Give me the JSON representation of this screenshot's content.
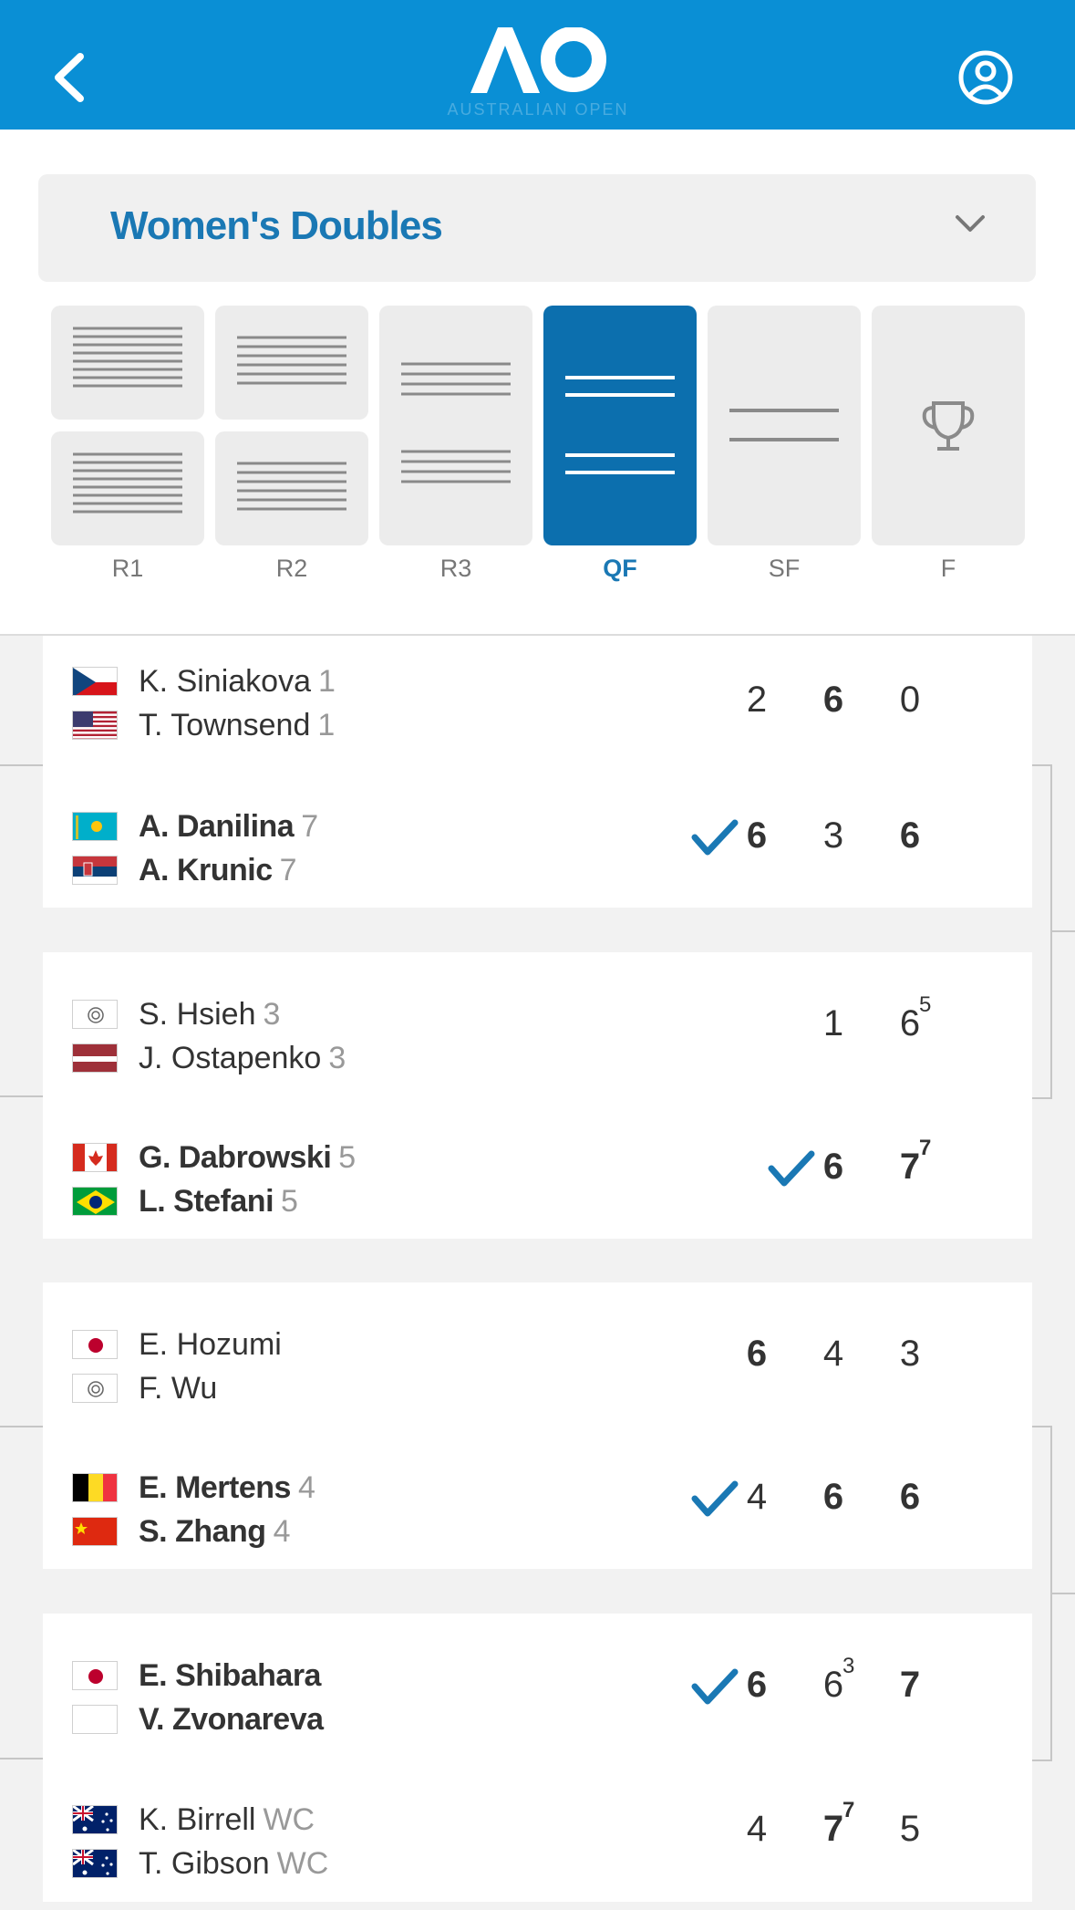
{
  "header": {
    "logo_text": "AO",
    "logo_subtext": "AUSTRALIAN OPEN",
    "brand_color": "#0a8fd5",
    "back_icon": "chevron-left-icon",
    "account_icon": "user-circle-icon"
  },
  "event_select": {
    "selected": "Women's Doubles",
    "icon": "chevron-down-icon"
  },
  "rounds": [
    {
      "label": "R1",
      "active": false
    },
    {
      "label": "R2",
      "active": false
    },
    {
      "label": "R3",
      "active": false
    },
    {
      "label": "QF",
      "active": true
    },
    {
      "label": "SF",
      "active": false
    },
    {
      "label": "F",
      "active": false,
      "icon": "trophy-icon"
    }
  ],
  "matches": [
    {
      "players": [
        {
          "name": "K. Siniakova",
          "seed": "1",
          "flag": "cze",
          "winner": false
        },
        {
          "name": "T. Townsend",
          "seed": "1",
          "flag": "usa",
          "winner": false
        }
      ],
      "won": false,
      "scores": [
        {
          "v": "2",
          "tb": "",
          "win": false
        },
        {
          "v": "6",
          "tb": "",
          "win": true
        },
        {
          "v": "0",
          "tb": "",
          "win": false
        }
      ]
    },
    {
      "players": [
        {
          "name": "A. Danilina",
          "seed": "7",
          "flag": "kaz",
          "winner": true
        },
        {
          "name": "A. Krunic",
          "seed": "7",
          "flag": "srb",
          "winner": true
        }
      ],
      "won": true,
      "scores": [
        {
          "v": "6",
          "tb": "",
          "win": true
        },
        {
          "v": "3",
          "tb": "",
          "win": false
        },
        {
          "v": "6",
          "tb": "",
          "win": true
        }
      ]
    },
    {
      "players": [
        {
          "name": "S. Hsieh",
          "seed": "3",
          "flag": "tpe",
          "winner": false
        },
        {
          "name": "J. Ostapenko",
          "seed": "3",
          "flag": "lat",
          "winner": false
        }
      ],
      "won": false,
      "scores": [
        {
          "v": "1",
          "tb": "",
          "win": false
        },
        {
          "v": "6",
          "tb": "5",
          "win": false
        }
      ]
    },
    {
      "players": [
        {
          "name": "G. Dabrowski",
          "seed": "5",
          "flag": "can",
          "winner": true
        },
        {
          "name": "L. Stefani",
          "seed": "5",
          "flag": "bra",
          "winner": true
        }
      ],
      "won": true,
      "scores": [
        {
          "v": "6",
          "tb": "",
          "win": true
        },
        {
          "v": "7",
          "tb": "7",
          "win": true
        }
      ]
    },
    {
      "players": [
        {
          "name": "E. Hozumi",
          "seed": "",
          "flag": "jpn",
          "winner": false
        },
        {
          "name": "F. Wu",
          "seed": "",
          "flag": "tpe",
          "winner": false
        }
      ],
      "won": false,
      "scores": [
        {
          "v": "6",
          "tb": "",
          "win": true
        },
        {
          "v": "4",
          "tb": "",
          "win": false
        },
        {
          "v": "3",
          "tb": "",
          "win": false
        }
      ]
    },
    {
      "players": [
        {
          "name": "E. Mertens",
          "seed": "4",
          "flag": "bel",
          "winner": true
        },
        {
          "name": "S. Zhang",
          "seed": "4",
          "flag": "chn",
          "winner": true
        }
      ],
      "won": true,
      "scores": [
        {
          "v": "4",
          "tb": "",
          "win": false
        },
        {
          "v": "6",
          "tb": "",
          "win": true
        },
        {
          "v": "6",
          "tb": "",
          "win": true
        }
      ]
    },
    {
      "players": [
        {
          "name": "E. Shibahara",
          "seed": "",
          "flag": "jpn",
          "winner": true
        },
        {
          "name": "V. Zvonareva",
          "seed": "",
          "flag": "blank",
          "winner": true
        }
      ],
      "won": true,
      "scores": [
        {
          "v": "6",
          "tb": "",
          "win": true
        },
        {
          "v": "6",
          "tb": "3",
          "win": false
        },
        {
          "v": "7",
          "tb": "",
          "win": true
        }
      ]
    },
    {
      "players": [
        {
          "name": "K. Birrell",
          "seed": "WC",
          "flag": "aus",
          "winner": false
        },
        {
          "name": "T. Gibson",
          "seed": "WC",
          "flag": "aus",
          "winner": false
        }
      ],
      "won": false,
      "scores": [
        {
          "v": "4",
          "tb": "",
          "win": false
        },
        {
          "v": "7",
          "tb": "7",
          "win": true
        },
        {
          "v": "5",
          "tb": "",
          "win": false
        }
      ]
    }
  ]
}
